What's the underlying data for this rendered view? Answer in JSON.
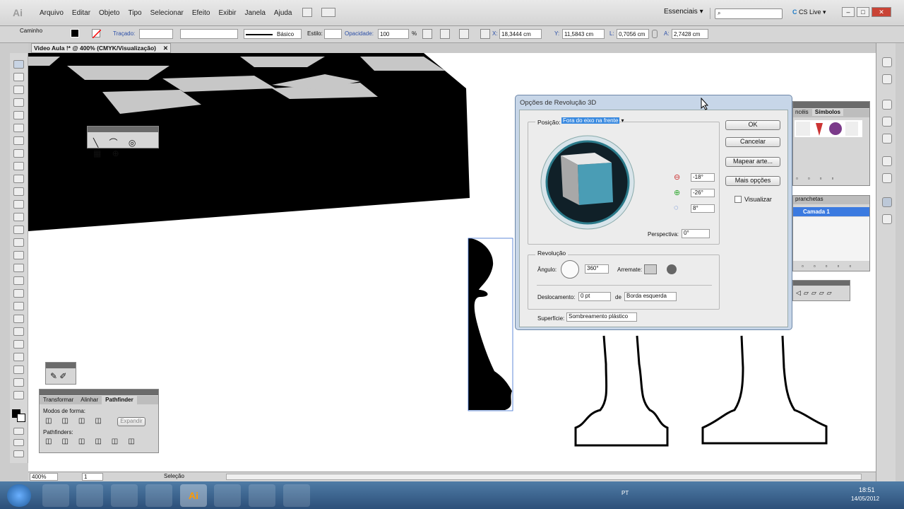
{
  "app": {
    "logo": "Ai",
    "workspace": "Essenciais",
    "cs_live": "CS Live"
  },
  "menu": [
    "Arquivo",
    "Editar",
    "Objeto",
    "Tipo",
    "Selecionar",
    "Efeito",
    "Exibir",
    "Janela",
    "Ajuda"
  ],
  "control": {
    "selection_label": "Caminho",
    "stroke_label": "Traçado:",
    "brush_label": "Básico",
    "style_label": "Estilo:",
    "opacity_label": "Opacidade:",
    "opacity_value": "100",
    "opacity_unit": "%",
    "x_label": "X:",
    "x_value": "18,3444 cm",
    "y_label": "Y:",
    "y_value": "11,5843 cm",
    "w_label": "L:",
    "w_value": "0,7056 cm",
    "h_label": "A:",
    "h_value": "2,7428 cm"
  },
  "document_tab": "Video Aula !* @ 400% (CMYK/Visualização)",
  "status": {
    "zoom": "400%",
    "page": "1",
    "mode": "Seleção"
  },
  "dialog": {
    "title": "Opções de Revolução 3D",
    "position_label": "Posição:",
    "position_value": "Fora do eixo na frente",
    "rot_x": "-18°",
    "rot_y": "-26°",
    "rot_z": "8°",
    "perspective_label": "Perspectiva:",
    "perspective_value": "0°",
    "revolution_label": "Revolução",
    "angle_label": "Ângulo:",
    "angle_value": "360°",
    "cap_label": "Arremate:",
    "offset_label": "Deslocamento:",
    "offset_value": "0 pt",
    "from_label": "de",
    "from_value": "Borda esquerda",
    "surface_label": "Superfície:",
    "surface_value": "Sombreamento plástico",
    "ok": "OK",
    "cancel": "Cancelar",
    "map_art": "Mapear arte...",
    "more_options": "Mais opções",
    "preview_label": "Visualizar",
    "cube_color": "#4a9db5"
  },
  "symbols_panel": {
    "tab1": "ncéis",
    "tab2": "Símbolos"
  },
  "layers_panel": {
    "tab": "pranchetas",
    "layer": "Camada 1"
  },
  "pathfinder_panel": {
    "tabs": [
      "Transformar",
      "Alinhar",
      "Pathfinder"
    ],
    "shape_modes": "Modos de forma:",
    "expand": "Expandir",
    "pathfinders": "Pathfinders:"
  },
  "taskbar": {
    "lang": "PT",
    "time": "18:51",
    "date": "14/05/2012"
  }
}
